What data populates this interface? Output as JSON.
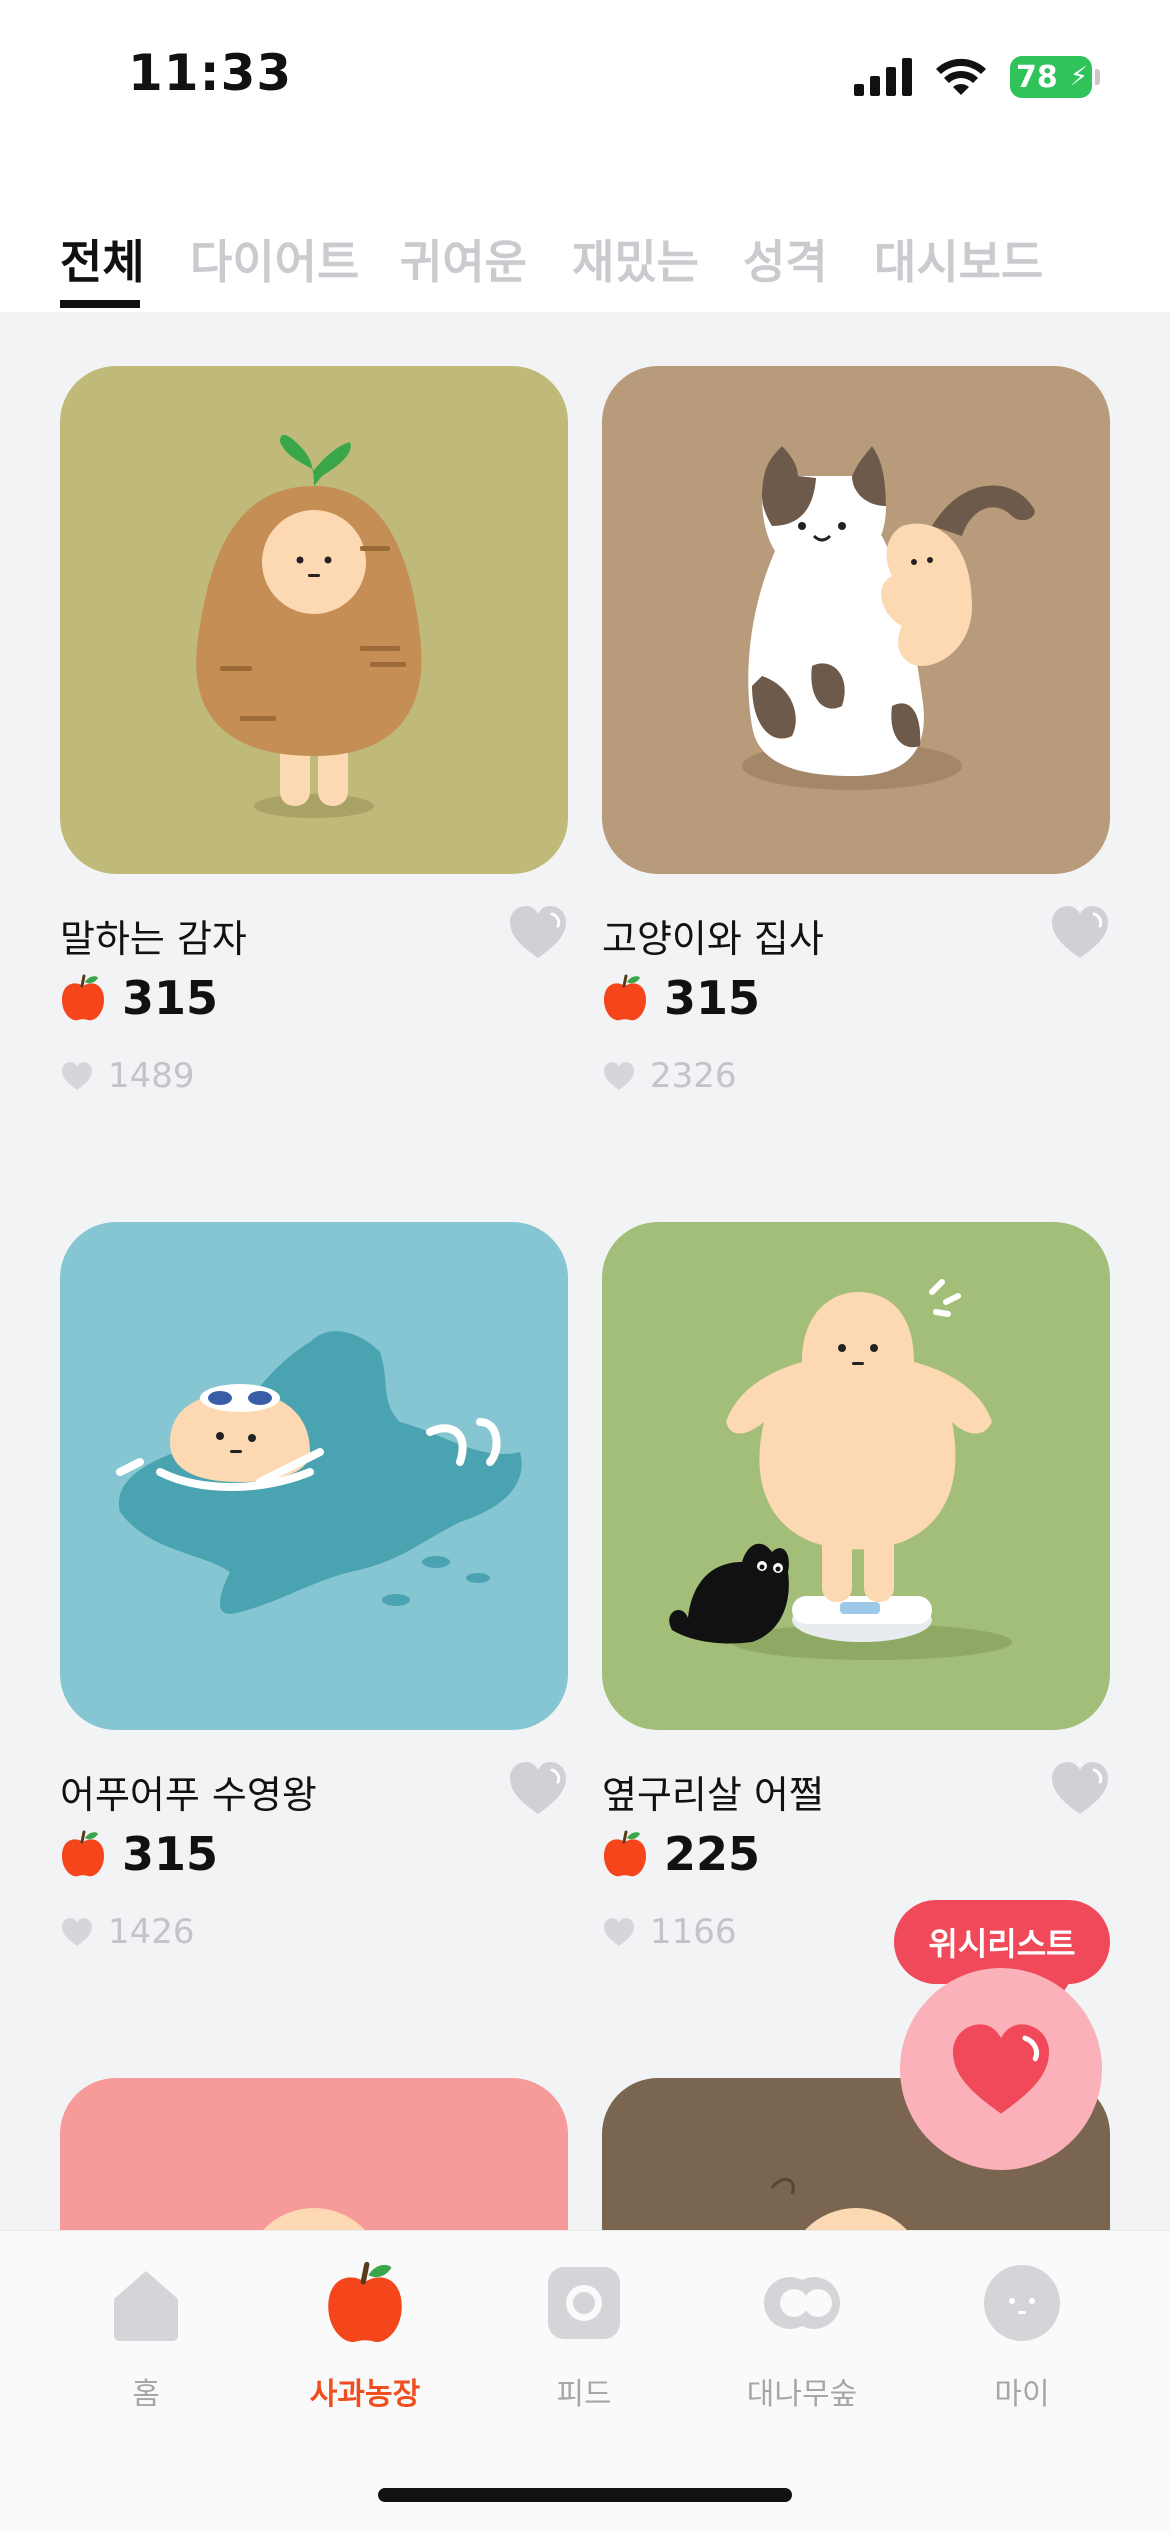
{
  "status_bar": {
    "time": "11:33",
    "battery": "78"
  },
  "tabs": [
    {
      "label": "전체",
      "active": true
    },
    {
      "label": "다이어트",
      "active": false
    },
    {
      "label": "귀여운",
      "active": false
    },
    {
      "label": "재밌는",
      "active": false
    },
    {
      "label": "성격",
      "active": false
    },
    {
      "label": "대시보드",
      "active": false
    }
  ],
  "items": [
    {
      "title": "말하는 감자",
      "price": "315",
      "likes": "1489",
      "bg": "#c0ba7a"
    },
    {
      "title": "고양이와 집사",
      "price": "315",
      "likes": "2326",
      "bg": "#b89b7b"
    },
    {
      "title": "어푸어푸 수영왕",
      "price": "315",
      "likes": "1426",
      "bg": "#86c6d2"
    },
    {
      "title": "옆구리살 어쩔",
      "price": "225",
      "likes": "1166",
      "bg": "#a3be78"
    },
    {
      "title": "",
      "price": "",
      "likes": "",
      "bg": "#f79a9a"
    },
    {
      "title": "",
      "price": "",
      "likes": "",
      "bg": "#7a6650"
    }
  ],
  "wishlist": {
    "label": "위시리스트"
  },
  "bottom_nav": [
    {
      "label": "홈",
      "icon": "home-icon",
      "active": false
    },
    {
      "label": "사과농장",
      "icon": "apple-icon",
      "active": true
    },
    {
      "label": "피드",
      "icon": "camera-icon",
      "active": false
    },
    {
      "label": "대나무숲",
      "icon": "bamboo-icon",
      "active": false
    },
    {
      "label": "마이",
      "icon": "face-icon",
      "active": false
    }
  ],
  "colors": {
    "accent": "#f04e1f",
    "wishlist": "#f04a5a",
    "muted": "#c2c4c8"
  }
}
